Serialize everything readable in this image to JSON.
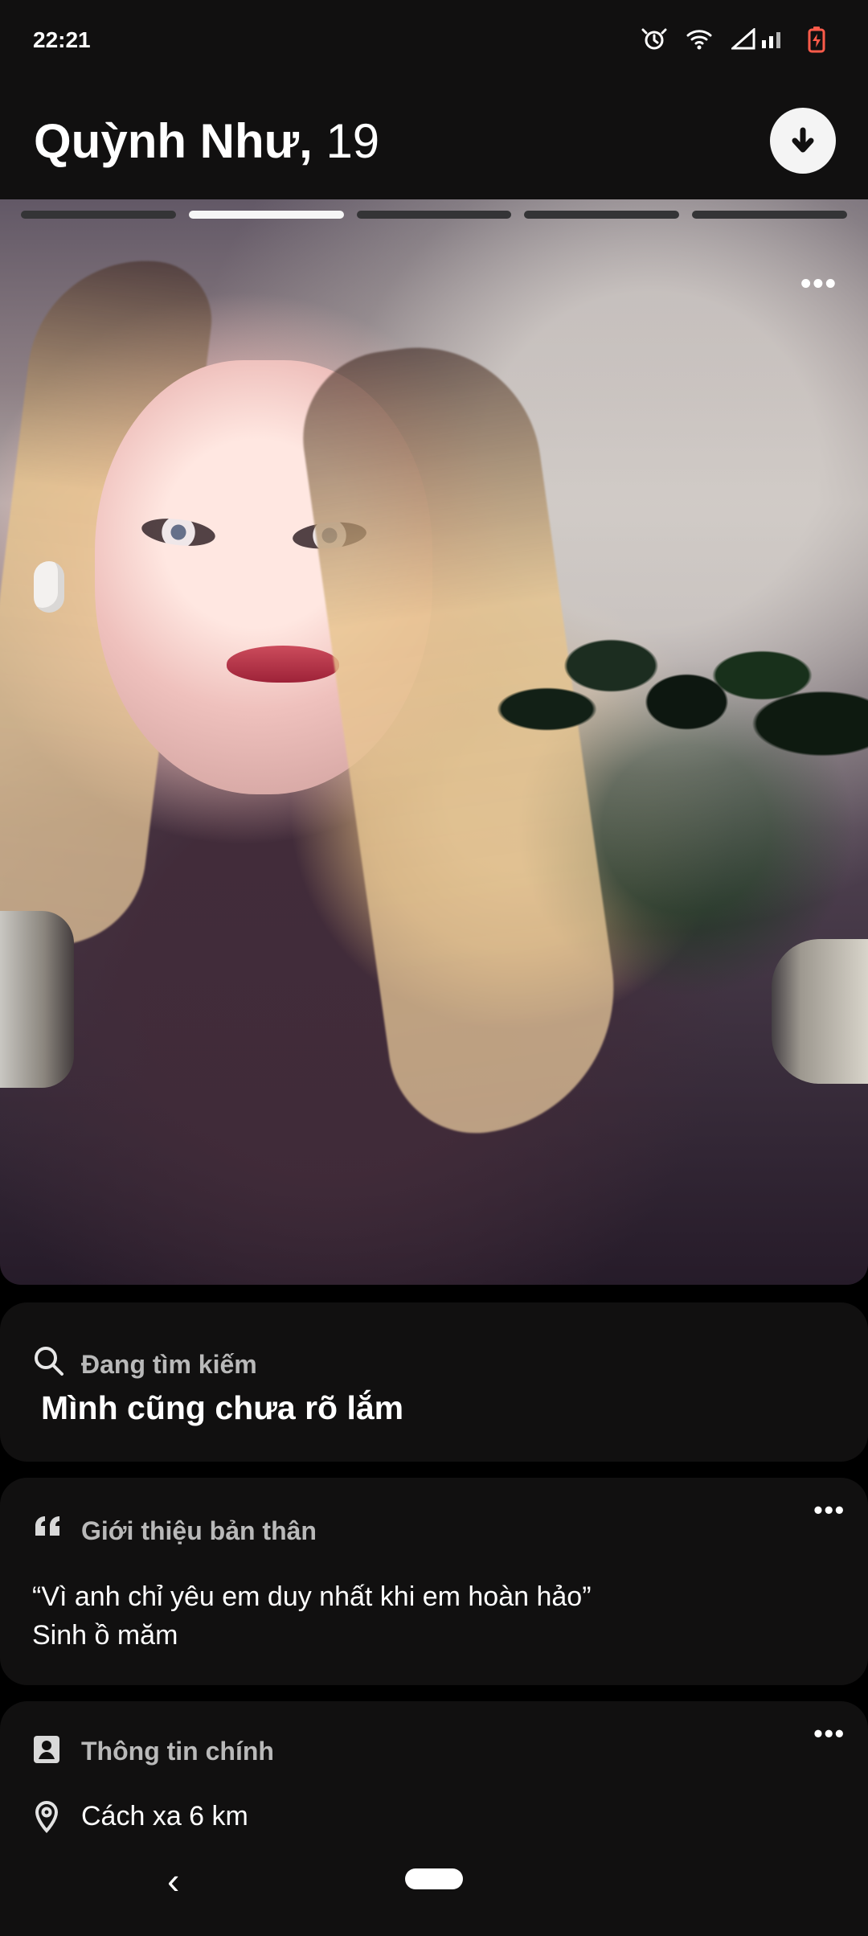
{
  "status_bar": {
    "time": "22:21",
    "icons": [
      "alarm-icon",
      "wifi-icon",
      "signal-icon",
      "battery-icon"
    ]
  },
  "profile": {
    "name": "Quỳnh Như,",
    "age": "19"
  },
  "photo": {
    "progress_count": 5,
    "active_index": 1
  },
  "sections": {
    "looking_for": {
      "label": "Đang tìm kiếm",
      "value": "Mình cũng chưa rõ lắm"
    },
    "about": {
      "label": "Giới thiệu bản thân",
      "text_line_1": "“Vì anh chỉ yêu em duy nhất khi em hoàn hảo”",
      "text_line_2": "Sinh ồ măm"
    },
    "main_info": {
      "label": "Thông tin chính",
      "distance": "Cách xa 6 km"
    }
  }
}
